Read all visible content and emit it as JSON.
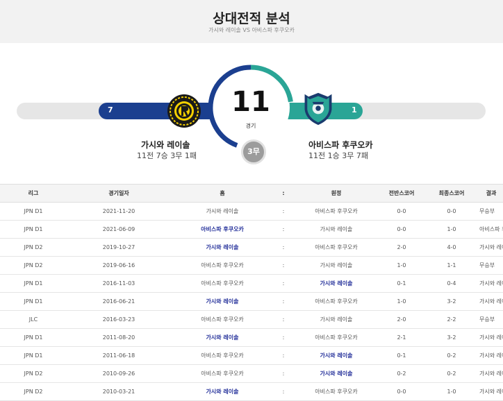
{
  "header": {
    "title": "상대전적 분석",
    "subtitle": "가시와 레이솔 VS 아비스파 후쿠오카"
  },
  "colors": {
    "home": "#1b3f8f",
    "away": "#2aa596",
    "draw": "#9c9c9c",
    "winner_text": "#24309a"
  },
  "summary": {
    "total_games": "11",
    "games_label": "경기",
    "draws": "3무",
    "home": {
      "name": "가시와 레이솔",
      "wins": "7",
      "record": "11전 7승 3무 1패",
      "logo": "kashiwa-reysol-crest"
    },
    "away": {
      "name": "아비스파 후쿠오카",
      "wins": "1",
      "record": "11전 1승 3무 7패",
      "logo": "avispa-fukuoka-crest"
    },
    "ring": {
      "home_games": 7,
      "away_games": 1,
      "draw_games": 3
    }
  },
  "table": {
    "headers": [
      "리그",
      "경기일자",
      "홈",
      ":",
      "원정",
      "전반스코어",
      "최종스코어",
      "결과"
    ],
    "rows": [
      {
        "league": "JPN D1",
        "date": "2021-11-20",
        "home": "가시와 레이솔",
        "sep": ":",
        "away": "아비스파 후쿠오카",
        "half": "0-0",
        "final": "0-0",
        "result": "무승부"
      },
      {
        "league": "JPN D1",
        "date": "2021-06-09",
        "home": "아비스파 후쿠오카",
        "sep": ":",
        "away": "가시와 레이솔",
        "half": "0-0",
        "final": "1-0",
        "result": "아비스파 후쿠오카"
      },
      {
        "league": "JPN D2",
        "date": "2019-10-27",
        "home": "가시와 레이솔",
        "sep": ":",
        "away": "아비스파 후쿠오카",
        "half": "2-0",
        "final": "4-0",
        "result": "가시와 레이솔(N)"
      },
      {
        "league": "JPN D2",
        "date": "2019-06-16",
        "home": "아비스파 후쿠오카",
        "sep": ":",
        "away": "가시와 레이솔",
        "half": "1-0",
        "final": "1-1",
        "result": "무승부"
      },
      {
        "league": "JPN D1",
        "date": "2016-11-03",
        "home": "아비스파 후쿠오카",
        "sep": ":",
        "away": "가시와 레이솔",
        "half": "0-1",
        "final": "0-4",
        "result": "가시와 레이솔(N)"
      },
      {
        "league": "JPN D1",
        "date": "2016-06-21",
        "home": "가시와 레이솔",
        "sep": ":",
        "away": "아비스파 후쿠오카",
        "half": "1-0",
        "final": "3-2",
        "result": "가시와 레이솔(N)"
      },
      {
        "league": "JLC",
        "date": "2016-03-23",
        "home": "아비스파 후쿠오카",
        "sep": ":",
        "away": "가시와 레이솔",
        "half": "2-0",
        "final": "2-2",
        "result": "무승부"
      },
      {
        "league": "JPN D1",
        "date": "2011-08-20",
        "home": "가시와 레이솔",
        "sep": ":",
        "away": "아비스파 후쿠오카",
        "half": "2-1",
        "final": "3-2",
        "result": "가시와 레이솔(N)"
      },
      {
        "league": "JPN D1",
        "date": "2011-06-18",
        "home": "아비스파 후쿠오카",
        "sep": ":",
        "away": "가시와 레이솔",
        "half": "0-1",
        "final": "0-2",
        "result": "가시와 레이솔(N)"
      },
      {
        "league": "JPN D2",
        "date": "2010-09-26",
        "home": "아비스파 후쿠오카",
        "sep": ":",
        "away": "가시와 레이솔",
        "half": "0-2",
        "final": "0-2",
        "result": "가시와 레이솔(N)"
      },
      {
        "league": "JPN D2",
        "date": "2010-03-21",
        "home": "가시와 레이솔",
        "sep": ":",
        "away": "아비스파 후쿠오카",
        "half": "0-0",
        "final": "1-0",
        "result": "가시와 레이솔(N)"
      }
    ]
  }
}
